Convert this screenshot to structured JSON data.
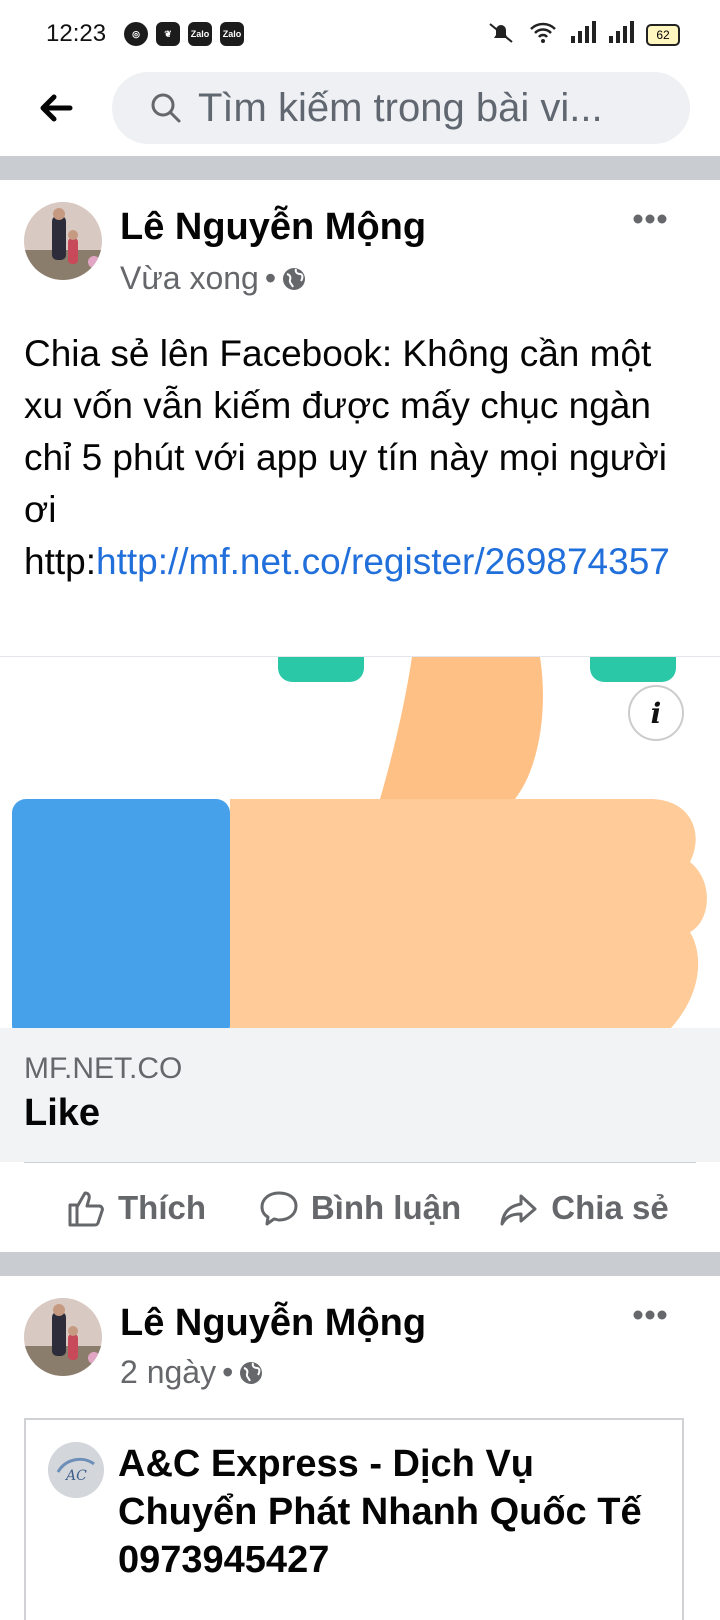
{
  "status_bar": {
    "time": "12:23",
    "app_icons": [
      "compass-icon",
      "leaf-icon",
      "Zalo",
      "Zalo"
    ],
    "battery": "62"
  },
  "search": {
    "placeholder": "Tìm kiếm trong bài vi..."
  },
  "posts": [
    {
      "author": "Lê Nguyễn Mộng",
      "time": "Vừa xong",
      "privacy": "globe-icon",
      "text_before": "Chia sẻ lên Facebook: Không cần một xu vốn vẫn kiếm được mấy chục ngàn chỉ 5 phút với app uy tín này mọi người ơi http:",
      "link": "http://mf.net.co/register/269874357",
      "preview": {
        "domain": "MF.NET.CO",
        "title": "Like"
      },
      "actions": [
        "Thích",
        "Bình luận",
        "Chia sẻ"
      ]
    },
    {
      "author": "Lê Nguyễn Mộng",
      "time": "2 ngày",
      "privacy": "globe-icon",
      "shared_card_title": "A&C Express - Dịch Vụ Chuyển Phát Nhanh Quốc Tế 0973945427"
    }
  ],
  "colors": {
    "link": "#216fdb",
    "thumb_blue": "#47a1ea",
    "thumb_skin": "#ffcc99",
    "accent_green": "#2bc8a8"
  }
}
